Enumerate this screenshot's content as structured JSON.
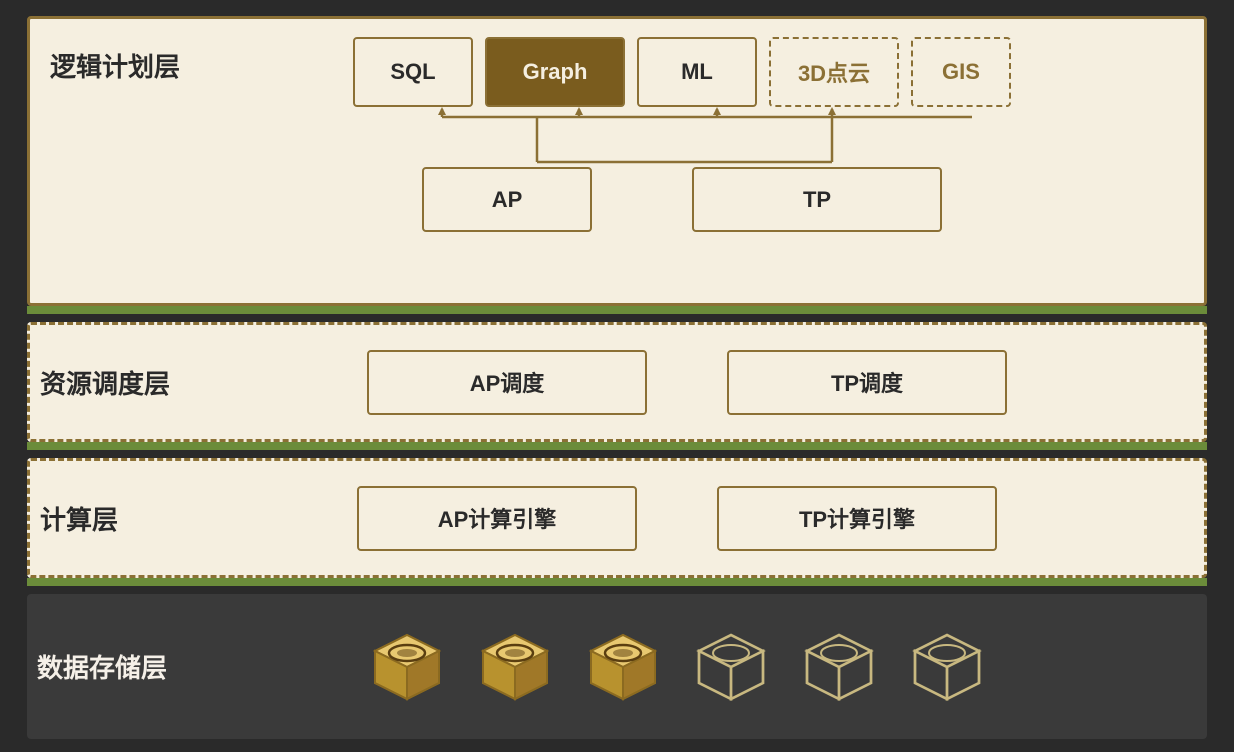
{
  "layers": {
    "logic": {
      "label": "逻辑计划层",
      "boxes_top": [
        {
          "id": "sql",
          "text": "SQL",
          "style": "solid"
        },
        {
          "id": "graph",
          "text": "Graph",
          "style": "highlighted"
        },
        {
          "id": "ml",
          "text": "ML",
          "style": "solid"
        },
        {
          "id": "3d",
          "text": "3D点云",
          "style": "dashed"
        },
        {
          "id": "gis",
          "text": "GIS",
          "style": "dashed"
        }
      ],
      "boxes_bottom": [
        {
          "id": "ap",
          "text": "AP"
        },
        {
          "id": "tp",
          "text": "TP"
        }
      ]
    },
    "schedule": {
      "label": "资源调度层",
      "boxes": [
        {
          "id": "ap-schedule",
          "text": "AP调度"
        },
        {
          "id": "tp-schedule",
          "text": "TP调度"
        }
      ]
    },
    "compute": {
      "label": "计算层",
      "boxes": [
        {
          "id": "ap-compute",
          "text": "AP计算引擎"
        },
        {
          "id": "tp-compute",
          "text": "TP计算引擎"
        }
      ]
    },
    "storage": {
      "label": "数据存储层",
      "cubes": [
        {
          "id": "cube1",
          "filled": true
        },
        {
          "id": "cube2",
          "filled": true
        },
        {
          "id": "cube3",
          "filled": true
        },
        {
          "id": "cube4",
          "filled": false
        },
        {
          "id": "cube5",
          "filled": false
        },
        {
          "id": "cube6",
          "filled": false
        }
      ]
    }
  },
  "colors": {
    "border_solid": "#8b7035",
    "border_dashed": "#8b7035",
    "bg_light": "#f5efe0",
    "bg_highlight": "#7a5c1e",
    "bg_storage": "#3a3a3a",
    "text_dark": "#2a2a2a",
    "text_light": "#f5f0e8",
    "text_gold": "#8b7035",
    "separator": "#6b8c3a",
    "cube_filled": "#c8a84b",
    "cube_outline": "#d4c89a"
  }
}
